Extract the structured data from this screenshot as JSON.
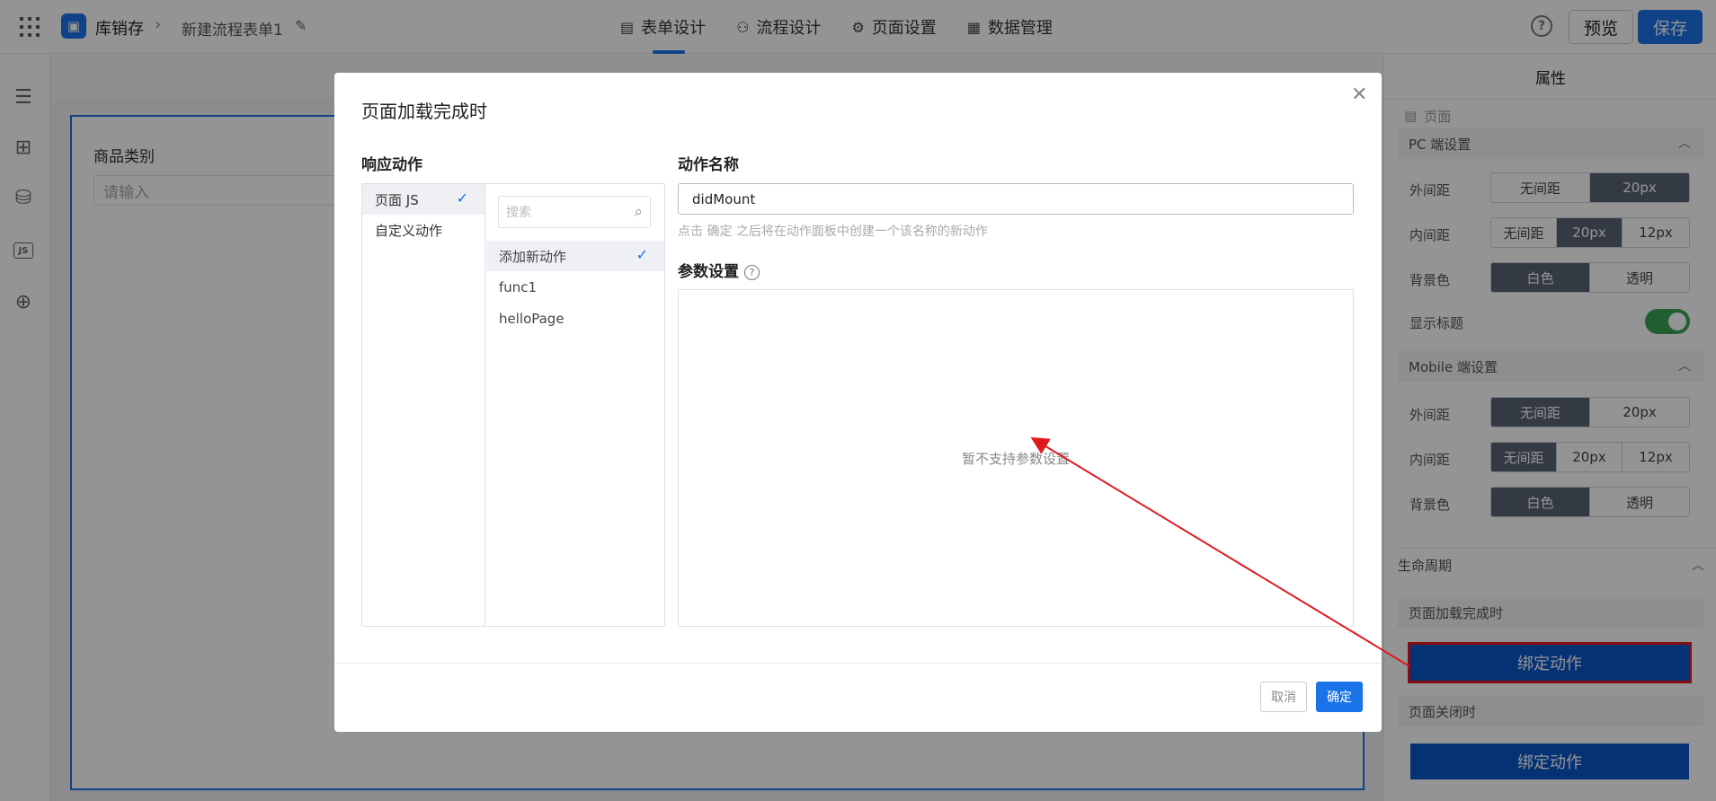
{
  "header": {
    "app_name": "库销存",
    "form_name": "新建流程表单1",
    "tabs": [
      {
        "label": "表单设计",
        "icon": "document-icon"
      },
      {
        "label": "流程设计",
        "icon": "flow-icon"
      },
      {
        "label": "页面设置",
        "icon": "gear-icon"
      },
      {
        "label": "数据管理",
        "icon": "table-icon"
      }
    ],
    "preview_label": "预览",
    "save_label": "保存"
  },
  "canvas": {
    "field_label": "商品类别",
    "field_placeholder": "请输入"
  },
  "right_panel": {
    "title": "属性",
    "crumb": "页面",
    "pc": {
      "title": "PC 端设置",
      "outer_label": "外间距",
      "outer_options": [
        "无间距",
        "20px"
      ],
      "inner_label": "内间距",
      "inner_options": [
        "无间距",
        "20px",
        "12px"
      ],
      "bg_label": "背景色",
      "bg_options": [
        "白色",
        "透明"
      ],
      "show_title_label": "显示标题"
    },
    "mobile": {
      "title": "Mobile 端设置",
      "outer_label": "外间距",
      "outer_options": [
        "无间距",
        "20px"
      ],
      "inner_label": "内间距",
      "inner_options": [
        "无间距",
        "20px",
        "12px"
      ],
      "bg_label": "背景色",
      "bg_options": [
        "白色",
        "透明"
      ]
    },
    "lifecycle": {
      "title": "生命周期",
      "on_load_label": "页面加载完成时",
      "bind_label": "绑定动作",
      "on_close_label": "页面关闭时",
      "bind_label_2": "绑定动作"
    }
  },
  "modal": {
    "title": "页面加载完成时",
    "response_title": "响应动作",
    "action_types": [
      "页面 JS",
      "自定义动作"
    ],
    "search_placeholder": "搜索",
    "functions": [
      "添加新动作",
      "func1",
      "helloPage"
    ],
    "name_title": "动作名称",
    "name_value": "didMount",
    "name_hint": "点击 确定 之后将在动作面板中创建一个该名称的新动作",
    "param_title": "参数设置",
    "param_empty": "暂不支持参数设置",
    "cancel_label": "取消",
    "ok_label": "确定"
  },
  "colors": {
    "accent": "#1a73e8",
    "bind_button": "#0a57c9",
    "highlight": "#e0191f",
    "segment_on": "#5b6575",
    "switch_on": "#3aa356"
  }
}
